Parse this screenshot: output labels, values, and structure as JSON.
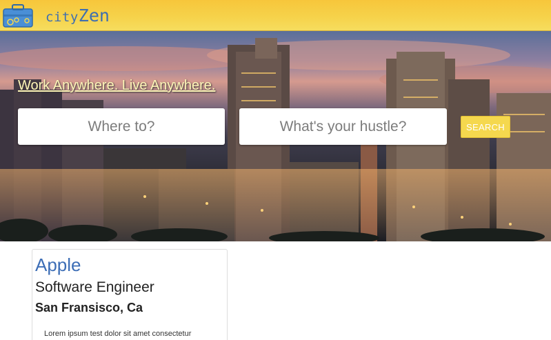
{
  "header": {
    "brand_part1": "city",
    "brand_part2": "Zen",
    "logo_icon": "briefcase-gears-icon",
    "colors": {
      "bar": "#f6d24a",
      "brand": "#3f6fb0"
    }
  },
  "hero": {
    "tagline": "Work Anywhere. Live Anywhere.",
    "search": {
      "where_placeholder": "Where to?",
      "hustle_placeholder": "What's your hustle?",
      "button_label": "SEARCH"
    },
    "background": "city-skyline-at-dusk"
  },
  "results": [
    {
      "company": "Apple",
      "title": "Software Engineer",
      "location": "San Fransisco, Ca",
      "description": "Lorem ipsum test dolor sit amet consectetur"
    }
  ]
}
